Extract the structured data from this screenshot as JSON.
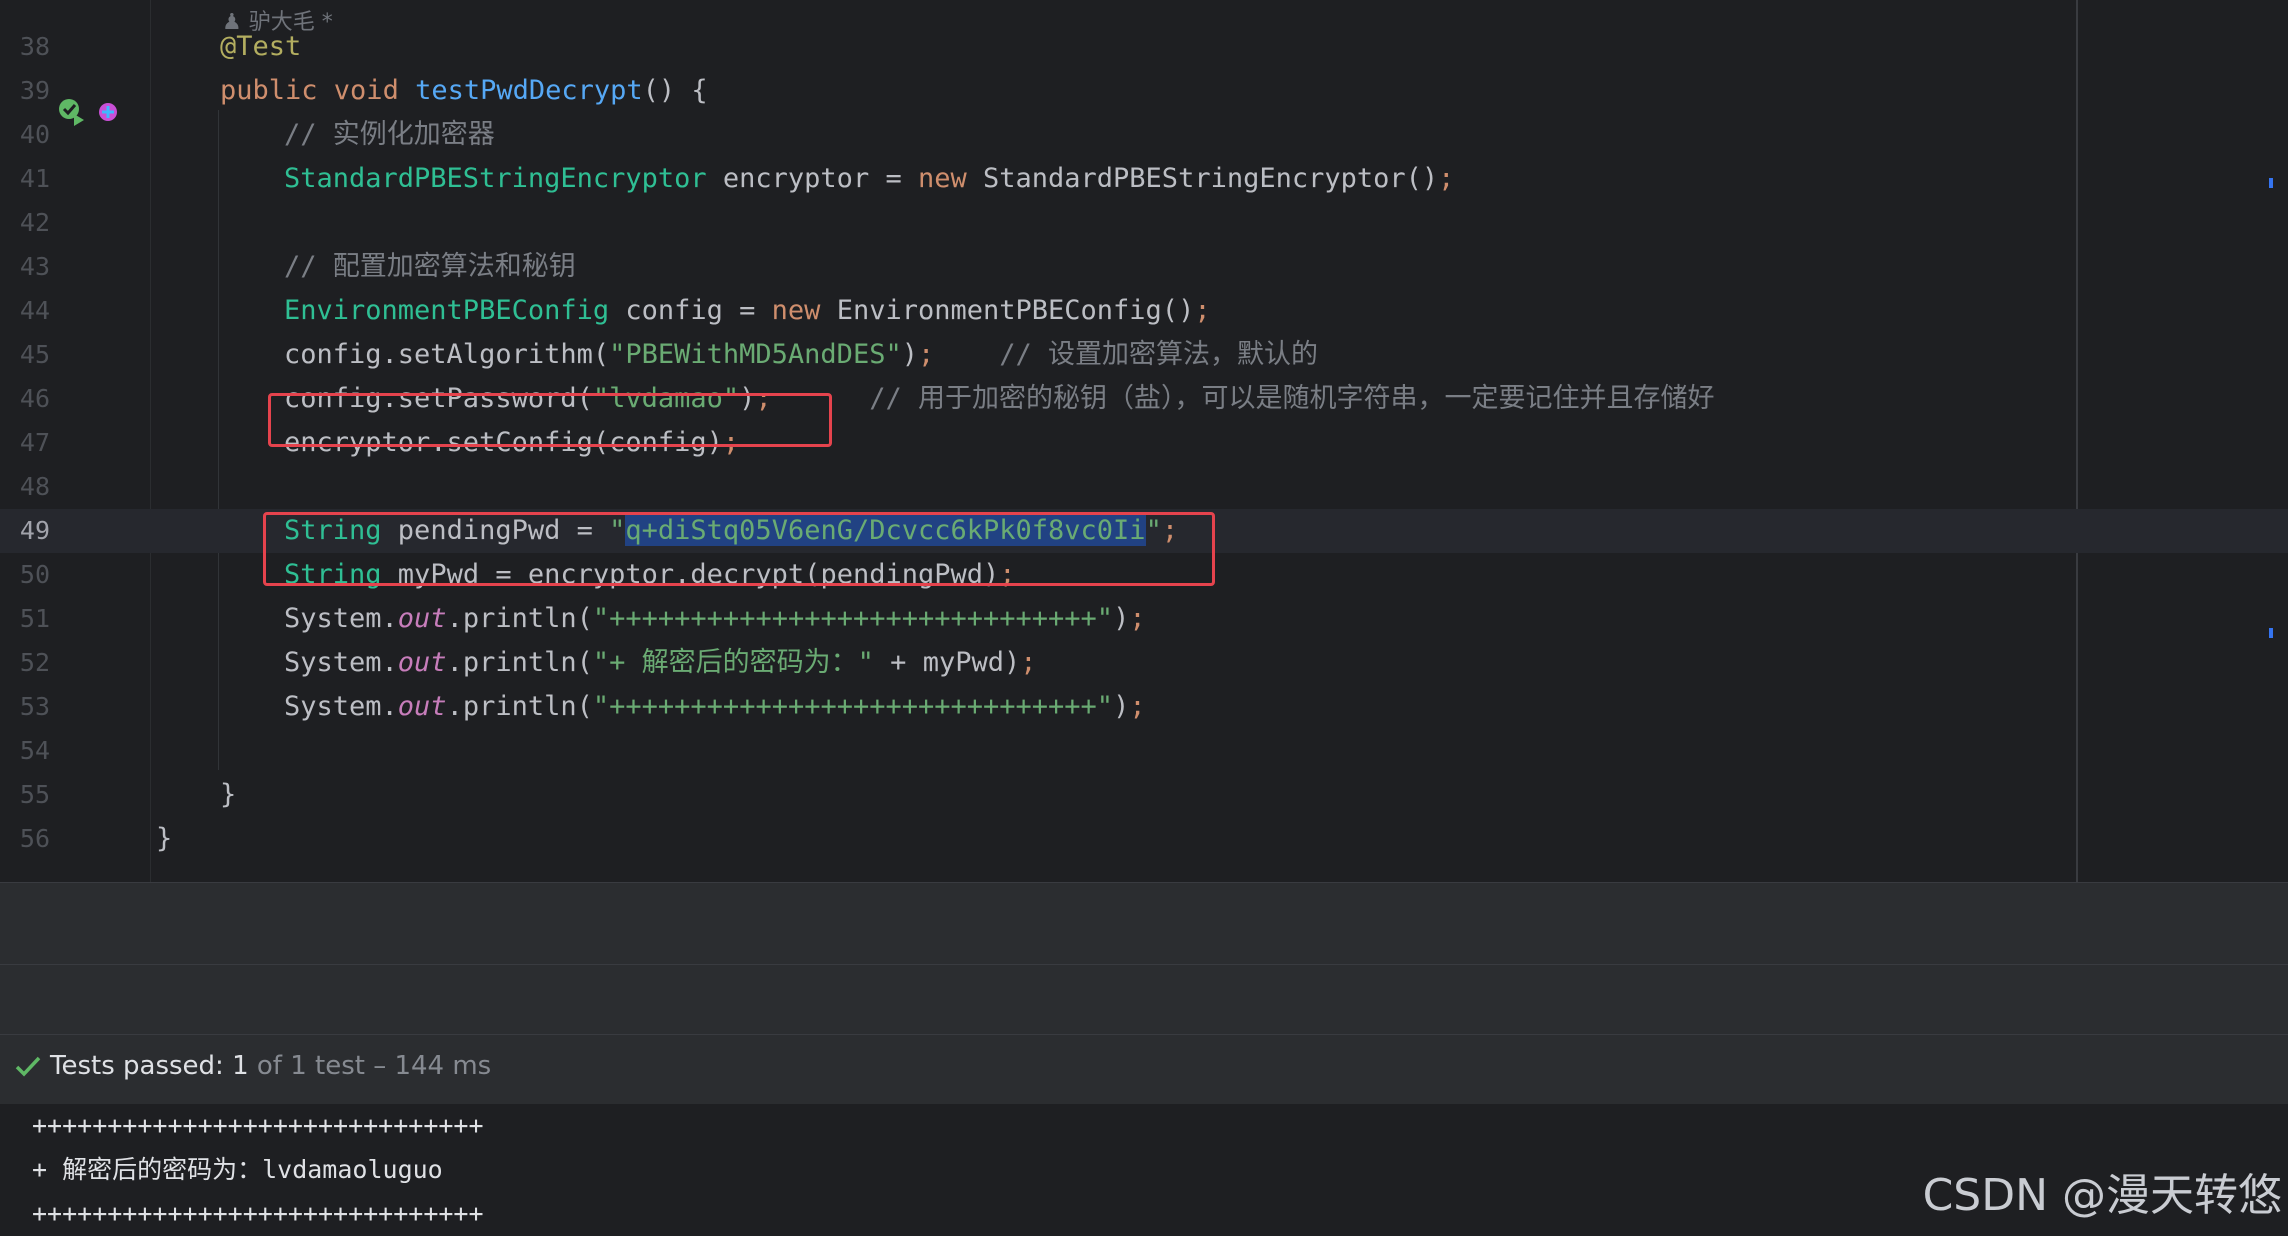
{
  "editor": {
    "author_hint": "驴大毛 *",
    "lines": [
      {
        "n": "38",
        "tokens": [
          [
            "ann",
            "@Test"
          ]
        ]
      },
      {
        "n": "39",
        "tokens": [
          [
            "kw",
            "public "
          ],
          [
            "kw",
            "void "
          ],
          [
            "fn",
            "testPwdDecrypt"
          ],
          [
            "",
            "() {"
          ]
        ]
      },
      {
        "n": "40",
        "tokens": [
          [
            "cm",
            "// 实例化加密器"
          ]
        ]
      },
      {
        "n": "41",
        "tokens": [
          [
            "cls",
            "StandardPBEStringEncryptor"
          ],
          [
            "",
            " encryptor = "
          ],
          [
            "kw",
            "new "
          ],
          [
            "",
            "StandardPBEStringEncryptor()"
          ],
          [
            "kw",
            ";"
          ]
        ]
      },
      {
        "n": "42",
        "tokens": []
      },
      {
        "n": "43",
        "tokens": [
          [
            "cm",
            "// 配置加密算法和秘钥"
          ]
        ]
      },
      {
        "n": "44",
        "tokens": [
          [
            "cls",
            "EnvironmentPBEConfig"
          ],
          [
            "",
            " config = "
          ],
          [
            "kw",
            "new "
          ],
          [
            "",
            "EnvironmentPBEConfig()"
          ],
          [
            "kw",
            ";"
          ]
        ]
      },
      {
        "n": "45",
        "tokens": [
          [
            "",
            "config.setAlgorithm("
          ],
          [
            "str",
            "\"PBEWithMD5AndDES\""
          ],
          [
            "",
            ")"
          ],
          [
            "kw",
            ";"
          ],
          [
            "",
            "    "
          ],
          [
            "cm",
            "// 设置加密算法，默认的"
          ]
        ]
      },
      {
        "n": "46",
        "tokens": [
          [
            "",
            "config.setPassword("
          ],
          [
            "str",
            "\"lvdamao\""
          ],
          [
            "",
            ")"
          ],
          [
            "kw",
            ";"
          ],
          [
            "",
            "      "
          ],
          [
            "cm",
            "// 用于加密的秘钥（盐），可以是随机字符串，一定要记住并且存储好"
          ]
        ]
      },
      {
        "n": "47",
        "tokens": [
          [
            "",
            "encryptor.setConfig(config)"
          ],
          [
            "kw",
            ";"
          ]
        ]
      },
      {
        "n": "48",
        "tokens": []
      },
      {
        "n": "49",
        "tokens": [
          [
            "cls",
            "String"
          ],
          [
            "",
            " pendingPwd = "
          ],
          [
            "str",
            "\""
          ],
          [
            "strsel",
            "q+diStq05V6enG/Dcvcc6kPk0f8vc0Ii"
          ],
          [
            "str",
            "\""
          ],
          [
            "kw",
            ";"
          ]
        ]
      },
      {
        "n": "50",
        "tokens": [
          [
            "cls",
            "String"
          ],
          [
            "",
            " myPwd = encryptor.decrypt(pendingPwd)"
          ],
          [
            "kw",
            ";"
          ]
        ]
      },
      {
        "n": "51",
        "tokens": [
          [
            "",
            "System."
          ],
          [
            "static",
            "out"
          ],
          [
            "",
            ".println("
          ],
          [
            "str",
            "\"++++++++++++++++++++++++++++++\""
          ],
          [
            "",
            ")"
          ],
          [
            "kw",
            ";"
          ]
        ]
      },
      {
        "n": "52",
        "tokens": [
          [
            "",
            "System."
          ],
          [
            "static",
            "out"
          ],
          [
            "",
            ".println("
          ],
          [
            "str",
            "\"+ 解密后的密码为：\""
          ],
          [
            "",
            " + myPwd)"
          ],
          [
            "kw",
            ";"
          ]
        ]
      },
      {
        "n": "53",
        "tokens": [
          [
            "",
            "System."
          ],
          [
            "static",
            "out"
          ],
          [
            "",
            ".println("
          ],
          [
            "str",
            "\"++++++++++++++++++++++++++++++\""
          ],
          [
            "",
            ")"
          ],
          [
            "kw",
            ";"
          ]
        ]
      },
      {
        "n": "54",
        "tokens": []
      },
      {
        "n": "55",
        "tokens": [
          [
            "",
            "}"
          ]
        ]
      },
      {
        "n": "56",
        "tokens": [
          [
            "",
            "}"
          ]
        ]
      }
    ]
  },
  "tests": {
    "status_label": "Tests passed: 1",
    "detail": " of 1 test – 144 ms"
  },
  "console": {
    "lines": [
      "++++++++++++++++++++++++++++++",
      "+ 解密后的密码为：lvdamaoluguo",
      "++++++++++++++++++++++++++++++"
    ]
  },
  "watermark": "CSDN @漫天转悠"
}
